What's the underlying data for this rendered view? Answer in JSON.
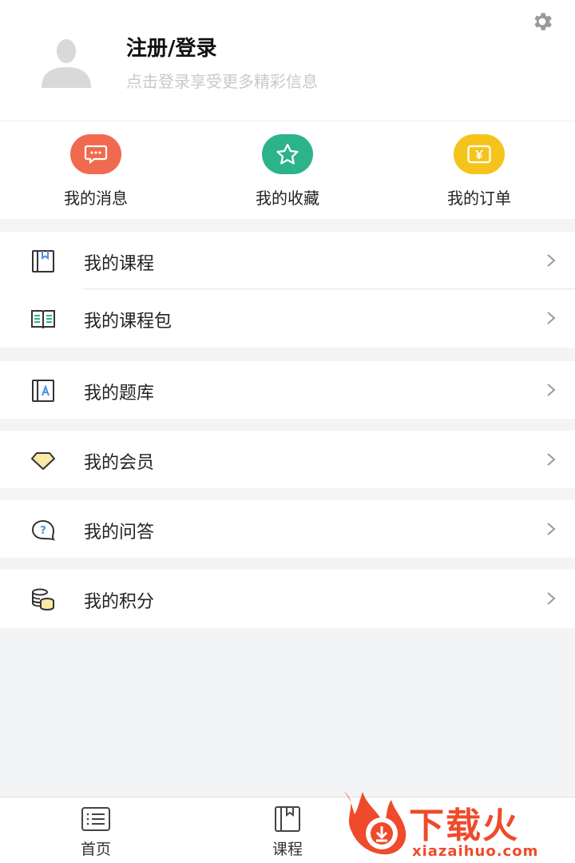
{
  "profile": {
    "title": "注册/登录",
    "subtitle": "点击登录享受更多精彩信息"
  },
  "quick_actions": [
    {
      "label": "我的消息",
      "icon": "message-icon",
      "color": "#f06a4f"
    },
    {
      "label": "我的收藏",
      "icon": "star-icon",
      "color": "#2db38a"
    },
    {
      "label": "我的订单",
      "icon": "order-yen-icon",
      "color": "#f5c41c"
    }
  ],
  "menu": {
    "courses": "我的课程",
    "course_packages": "我的课程包",
    "question_bank": "我的题库",
    "membership": "我的会员",
    "qa": "我的问答",
    "points": "我的积分"
  },
  "tabbar": {
    "home": "首页",
    "courses": "课程"
  },
  "watermark": {
    "brand": "下载火",
    "url": "xiazaihuo.com"
  },
  "colors": {
    "accent_red": "#ef4a2b",
    "background": "#f3f4f6"
  }
}
